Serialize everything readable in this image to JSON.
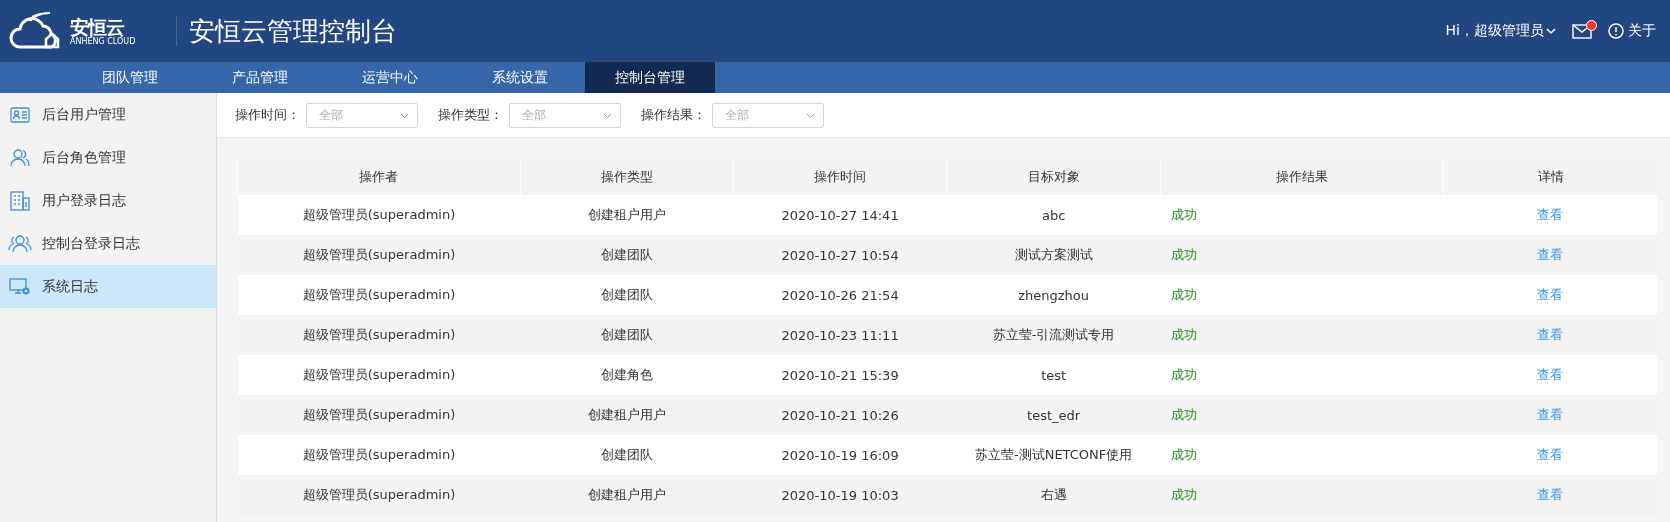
{
  "header": {
    "logo_text": "安恒云",
    "logo_subtext": "ANHENG CLOUD",
    "title": "安恒云管理控制台",
    "user": "Hi，超级管理员",
    "mail_unread": true,
    "about": "关于"
  },
  "nav": [
    {
      "label": "团队管理",
      "selected": false
    },
    {
      "label": "产品管理",
      "selected": false
    },
    {
      "label": "运营中心",
      "selected": false
    },
    {
      "label": "系统设置",
      "selected": false
    },
    {
      "label": "控制台管理",
      "selected": true
    }
  ],
  "sidebar": {
    "items": [
      {
        "label": "后台用户管理",
        "selected": false
      },
      {
        "label": "后台角色管理",
        "selected": false
      },
      {
        "label": "用户登录日志",
        "selected": false
      },
      {
        "label": "控制台登录日志",
        "selected": false
      },
      {
        "label": "系统日志",
        "selected": true
      }
    ]
  },
  "filters": [
    {
      "label": "操作时间：",
      "placeholder": "全部"
    },
    {
      "label": "操作类型：",
      "placeholder": "全部"
    },
    {
      "label": "操作结果：",
      "placeholder": "全部"
    }
  ],
  "table": {
    "columns": [
      "操作者",
      "操作类型",
      "操作时间",
      "目标对象",
      "操作结果",
      "详情"
    ],
    "rows": [
      [
        "超级管理员(superadmin)",
        "创建租户用户",
        "2020-10-27 14:41",
        "abc",
        "成功",
        "查看"
      ],
      [
        "超级管理员(superadmin)",
        "创建团队",
        "2020-10-27 10:54",
        "测试方案测试",
        "成功",
        "查看"
      ],
      [
        "超级管理员(superadmin)",
        "创建团队",
        "2020-10-26 21:54",
        "zhengzhou",
        "成功",
        "查看"
      ],
      [
        "超级管理员(superadmin)",
        "创建团队",
        "2020-10-23 11:11",
        "苏立莹-引流测试专用",
        "成功",
        "查看"
      ],
      [
        "超级管理员(superadmin)",
        "创建角色",
        "2020-10-21 15:39",
        "test",
        "成功",
        "查看"
      ],
      [
        "超级管理员(superadmin)",
        "创建租户用户",
        "2020-10-21 10:26",
        "test_edr",
        "成功",
        "查看"
      ],
      [
        "超级管理员(superadmin)",
        "创建团队",
        "2020-10-19 16:09",
        "苏立莹-测试NETCONF使用",
        "成功",
        "查看"
      ],
      [
        "超级管理员(superadmin)",
        "创建租户用户",
        "2020-10-19 10:03",
        "右遇",
        "成功",
        "查看"
      ]
    ]
  }
}
